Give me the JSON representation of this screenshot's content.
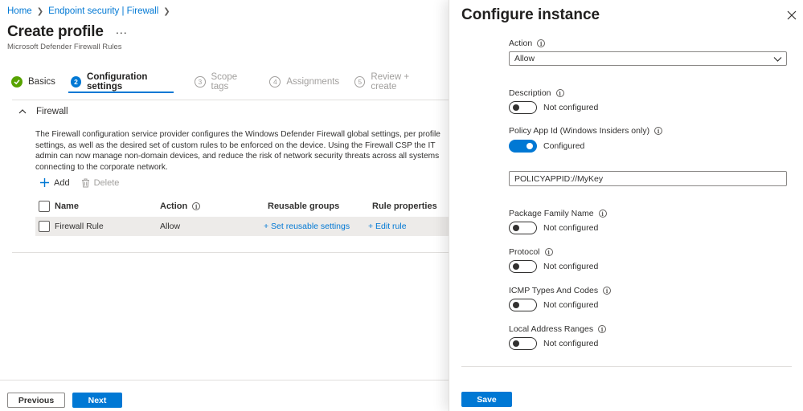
{
  "breadcrumb": {
    "home": "Home",
    "endpoint": "Endpoint security | Firewall"
  },
  "header": {
    "title": "Create profile",
    "more": "...",
    "subtitle": "Microsoft Defender Firewall Rules"
  },
  "steps": [
    {
      "num": "",
      "label": "Basics",
      "state": "done"
    },
    {
      "num": "2",
      "label": "Configuration settings",
      "state": "active"
    },
    {
      "num": "3",
      "label": "Scope tags",
      "state": "pending"
    },
    {
      "num": "4",
      "label": "Assignments",
      "state": "pending"
    },
    {
      "num": "5",
      "label": "Review + create",
      "state": "pending"
    }
  ],
  "section": {
    "title": "Firewall",
    "description": "The Firewall configuration service provider configures the Windows Defender Firewall global settings, per profile settings, as well as the desired set of custom rules to be enforced on the device. Using the Firewall CSP the IT admin can now manage non-domain devices, and reduce the risk of network security threats across all systems connecting to the corporate network."
  },
  "commands": {
    "add": "Add",
    "delete": "Delete"
  },
  "table": {
    "columns": {
      "name": "Name",
      "action": "Action",
      "reusable": "Reusable groups",
      "rule_props": "Rule properties"
    },
    "rows": [
      {
        "name": "Firewall Rule",
        "action": "Allow",
        "reusable": "+ Set reusable settings",
        "rule_props": "+ Edit rule"
      }
    ]
  },
  "footer": {
    "previous": "Previous",
    "next": "Next"
  },
  "panel": {
    "title": "Configure instance",
    "action_label": "Action",
    "action_value": "Allow",
    "description_label": "Description",
    "description_state": "Not configured",
    "policy_app_label": "Policy App Id (Windows Insiders only)",
    "policy_app_state": "Configured",
    "policy_app_value": "POLICYAPPID://MyKey",
    "package_label": "Package Family Name",
    "package_state": "Not configured",
    "protocol_label": "Protocol",
    "protocol_state": "Not configured",
    "icmp_label": "ICMP Types And Codes",
    "icmp_state": "Not configured",
    "local_addr_label": "Local Address Ranges",
    "local_addr_state": "Not configured",
    "save": "Save"
  },
  "colors": {
    "accent": "#0078d4",
    "success": "#57a300"
  }
}
